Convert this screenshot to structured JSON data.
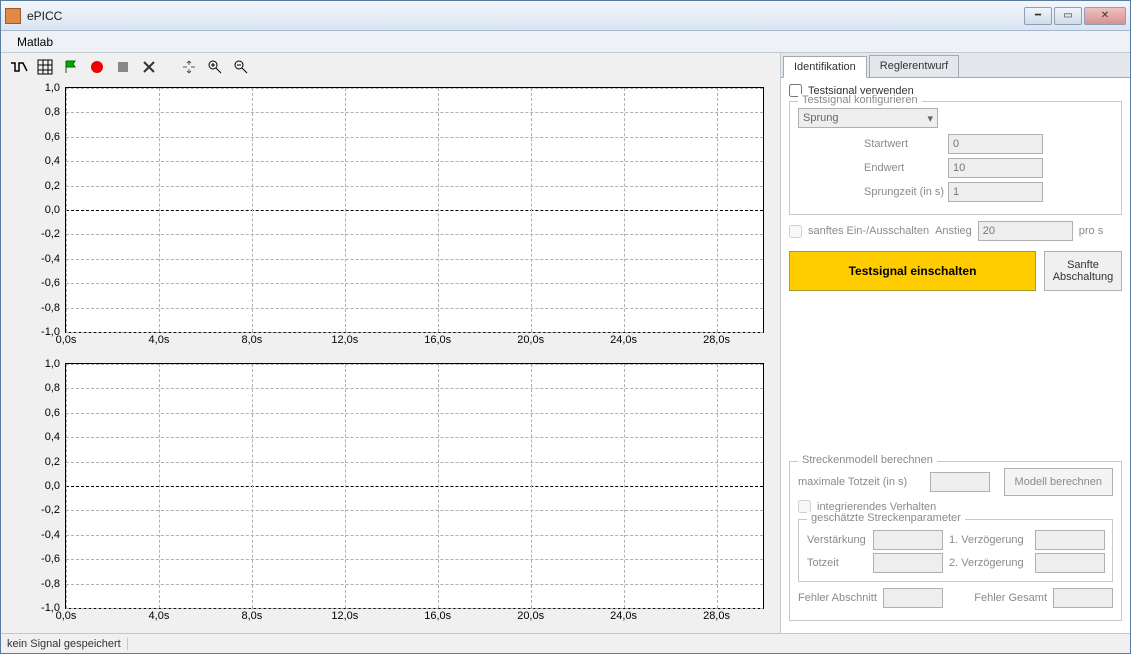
{
  "title": "ePICC",
  "menu": {
    "matlab": "Matlab"
  },
  "tabs": {
    "identifikation": "Identifikation",
    "reglerentwurf": "Reglerentwurf"
  },
  "identifikation": {
    "testsignal_verwenden": "Testsignal verwenden",
    "fieldset_title": "Testsignal konfigurieren",
    "signal_type": "Sprung",
    "startwert_label": "Startwert",
    "startwert_value": "0",
    "endwert_label": "Endwert",
    "endwert_value": "10",
    "sprungzeit_label": "Sprungzeit (in s)",
    "sprungzeit_value": "1",
    "sanftes_label": "sanftes Ein-/Ausschalten",
    "anstieg_label": "Anstieg",
    "anstieg_value": "20",
    "anstieg_unit": "pro s",
    "einschalten_btn": "Testsignal einschalten",
    "sanfte_btn": "Sanfte Abschaltung",
    "strecken_fieldset": "Streckenmodell berechnen",
    "max_totzeit_label": "maximale Totzeit (in s)",
    "integrierend_label": "integrierendes Verhalten",
    "modell_btn": "Modell berechnen",
    "param_fieldset": "geschätzte Streckenparameter",
    "verstaerkung": "Verstärkung",
    "verz1": "1. Verzögerung",
    "totzeit": "Totzeit",
    "verz2": "2. Verzögerung",
    "fehler_abschnitt": "Fehler Abschnitt",
    "fehler_gesamt": "Fehler Gesamt"
  },
  "status": "kein Signal gespeichert",
  "chart_data": [
    {
      "type": "line",
      "title": "",
      "x": [],
      "y": [],
      "xlabel": "",
      "ylabel": "",
      "xlim": [
        0,
        30
      ],
      "ylim": [
        -1.0,
        1.0
      ],
      "xticks": [
        "0,0s",
        "4,0s",
        "8,0s",
        "12,0s",
        "16,0s",
        "20,0s",
        "24,0s",
        "28,0s"
      ],
      "yticks": [
        "-1,0",
        "-0,8",
        "-0,6",
        "-0,4",
        "-0,2",
        "0,0",
        "0,2",
        "0,4",
        "0,6",
        "0,8",
        "1,0"
      ]
    },
    {
      "type": "line",
      "title": "",
      "x": [],
      "y": [],
      "xlabel": "",
      "ylabel": "",
      "xlim": [
        0,
        30
      ],
      "ylim": [
        -1.0,
        1.0
      ],
      "xticks": [
        "0,0s",
        "4,0s",
        "8,0s",
        "12,0s",
        "16,0s",
        "20,0s",
        "24,0s",
        "28,0s"
      ],
      "yticks": [
        "-1,0",
        "-0,8",
        "-0,6",
        "-0,4",
        "-0,2",
        "0,0",
        "0,2",
        "0,4",
        "0,6",
        "0,8",
        "1,0"
      ]
    }
  ]
}
